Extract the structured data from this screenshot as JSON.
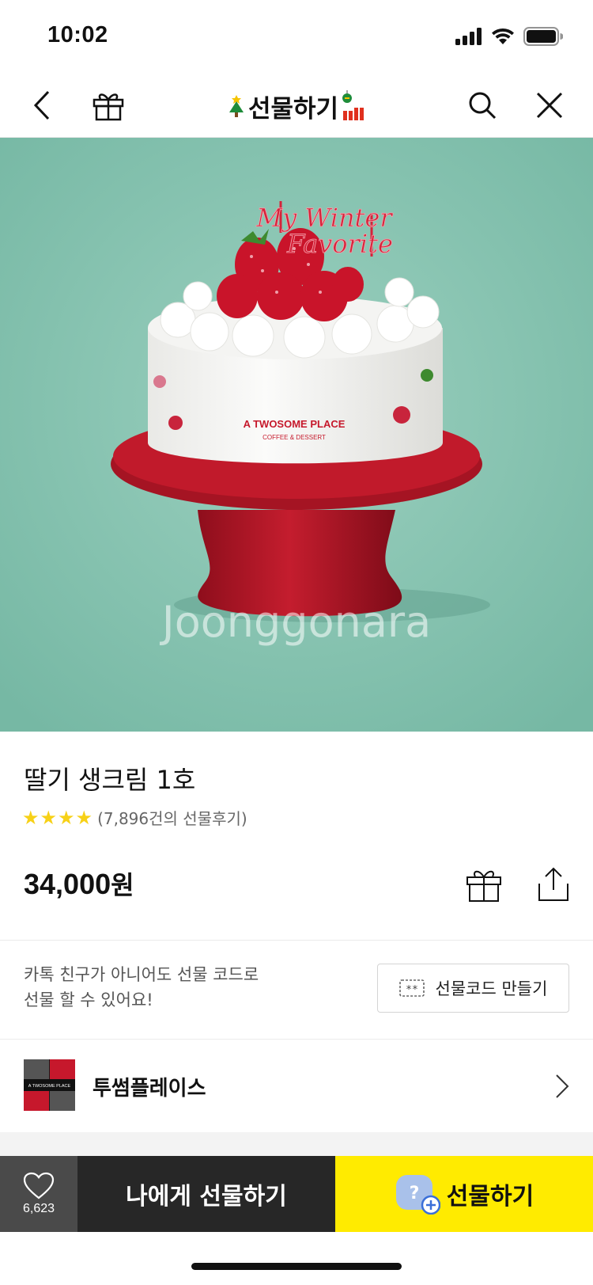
{
  "status_bar": {
    "time": "10:02"
  },
  "nav": {
    "title": "선물하기"
  },
  "product": {
    "name": "딸기 생크림 1호",
    "rating_stars": 4,
    "review_count": "(7,896건의 선물후기)",
    "price_number": "34,000",
    "price_unit": "원"
  },
  "hero": {
    "watermark": "Joonggonara",
    "topper_line1": "My Winter",
    "topper_line2": "Favorite",
    "cake_brand": "A TWOSOME PLACE",
    "cake_sub": "COFFEE & DESSERT"
  },
  "gift_code": {
    "description_line1": "카톡 친구가 아니어도 선물 코드로",
    "description_line2": "선물 할 수 있어요!",
    "button_label": "선물코드 만들기",
    "button_icon_text": "**"
  },
  "brand": {
    "name": "투썸플레이스",
    "logo_text": "A TWOSOME PLACE"
  },
  "actions": {
    "like_count": "6,623",
    "self_gift_label": "나에게 선물하기",
    "gift_label": "선물하기",
    "gift_icon_text": "?"
  },
  "colors": {
    "accent_yellow": "#ffeb00",
    "star_yellow": "#f7d117",
    "hero_bg": "#8cc5b3",
    "dark_button": "#272727"
  }
}
